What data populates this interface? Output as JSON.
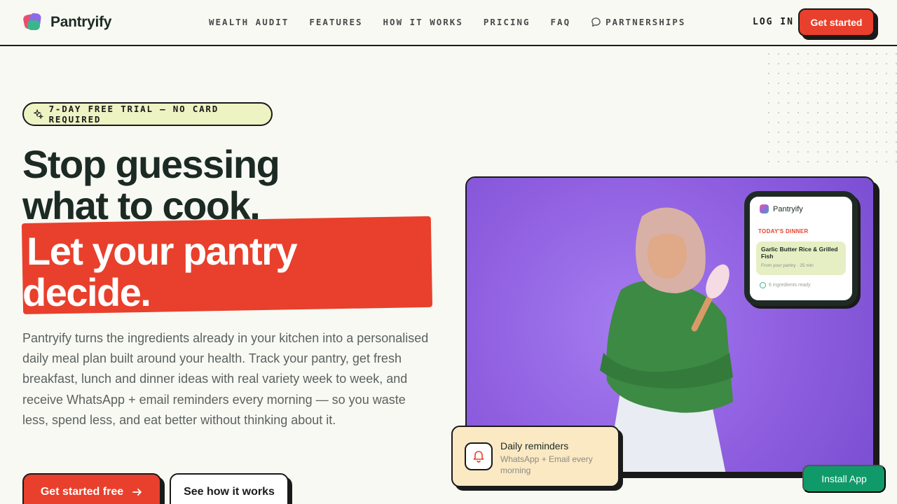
{
  "header": {
    "brand": "Pantryify",
    "nav": [
      "WEALTH AUDIT",
      "FEATURES",
      "HOW IT WORKS",
      "PRICING",
      "FAQ",
      "PARTNERSHIPS"
    ],
    "login": "LOG IN",
    "cta": "Get started"
  },
  "hero": {
    "badge": "7-DAY FREE TRIAL — NO CARD REQUIRED",
    "headline_1": "Stop guessing",
    "headline_2": "what to cook.",
    "highlight_1": "Let your pantry",
    "highlight_2": "decide.",
    "description": "Pantryify turns the ingredients already in your kitchen into a personalised daily meal plan built around your health. Track your pantry, get fresh breakfast, lunch and dinner ideas with real variety week to week, and receive WhatsApp + email reminders every morning — so you waste less, spend less, and eat better without thinking about it.",
    "primary_cta": "Get started free",
    "secondary_cta": "See how it works"
  },
  "phone": {
    "brand": "Pantryify",
    "label": "TODAY'S DINNER",
    "meal": "Garlic Butter Rice & Grilled Fish",
    "meta": "From your pantry · 25 min",
    "ready": "6 ingredients ready"
  },
  "reminder": {
    "title": "Daily reminders",
    "subtitle": "WhatsApp + Email every morning"
  },
  "install": "Install App",
  "colors": {
    "accent": "#e8402c",
    "background": "#f9f9f4",
    "hero_bg": "#9b6de0",
    "install": "#109a6a"
  }
}
